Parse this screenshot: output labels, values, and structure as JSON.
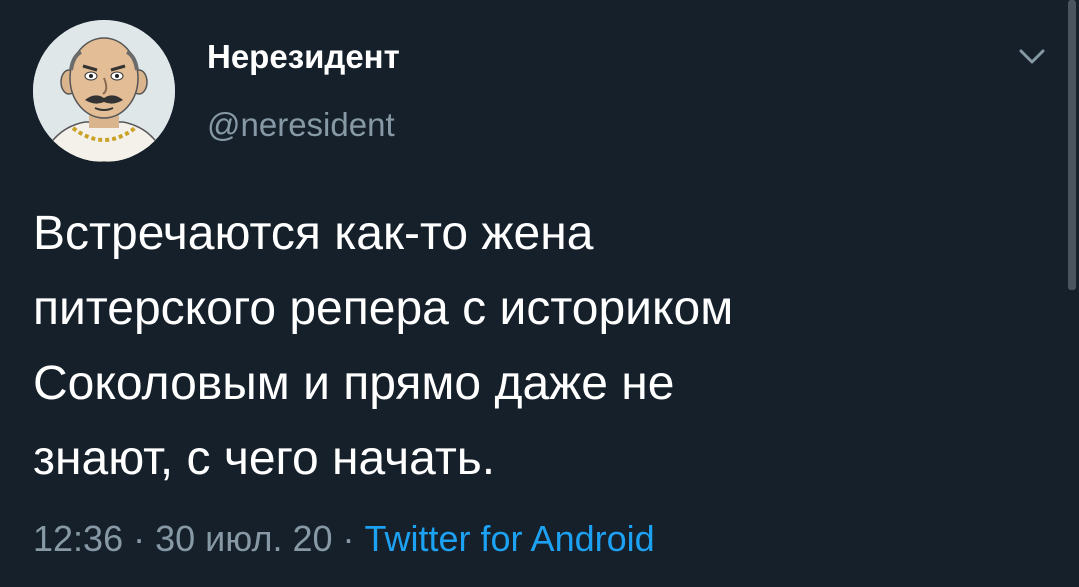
{
  "author": {
    "display_name": "Нерезидент",
    "handle": "@neresident",
    "avatar_icon": "cartoon-avatar-icon"
  },
  "tweet": {
    "text": "Встречаются как-то жена\nпитерского репера с историком\nСоколовым и прямо даже не\nзнают, с чего начать.",
    "time": "12:36",
    "date": "30 июл. 20",
    "separator": " · ",
    "source": "Twitter for Android"
  },
  "menu": {
    "icon": "chevron-down-icon"
  },
  "colors": {
    "background": "#15202b",
    "primary_text": "#ffffff",
    "secondary_text": "#8899a6",
    "link": "#1da1f2"
  }
}
